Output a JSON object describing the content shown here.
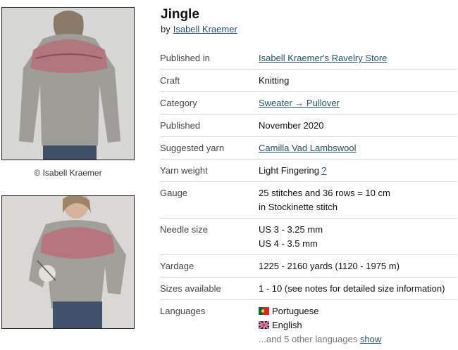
{
  "pattern": {
    "title": "Jingle",
    "by_prefix": "by",
    "designer": "Isabell Kraemer"
  },
  "photos": {
    "caption": "© Isabell Kraemer",
    "icons": [
      "sweater-back-photo",
      "sweater-front-photo"
    ]
  },
  "details": {
    "published_in": {
      "label": "Published in",
      "value": "Isabell Kraemer's Ravelry Store"
    },
    "craft": {
      "label": "Craft",
      "value": "Knitting"
    },
    "category": {
      "label": "Category",
      "value": "Sweater → Pullover"
    },
    "published": {
      "label": "Published",
      "value": "November 2020"
    },
    "yarn": {
      "label": "Suggested yarn",
      "value": "Camilla Vad Lambswool"
    },
    "weight": {
      "label": "Yarn weight",
      "value": "Light Fingering",
      "help": "?"
    },
    "gauge": {
      "label": "Gauge",
      "line1": "25 stitches and 36 rows = 10 cm",
      "line2": "in Stockinette stitch"
    },
    "needles": {
      "label": "Needle size",
      "line1": "US 3 - 3.25 mm",
      "line2": "US 4 - 3.5 mm"
    },
    "yardage": {
      "label": "Yardage",
      "value": "1225 - 2160 yards (1120 - 1975 m)"
    },
    "sizes": {
      "label": "Sizes available",
      "value": "1 - 10 (see notes for detailed size information)"
    },
    "languages": {
      "label": "Languages",
      "items": [
        {
          "name": "Portuguese",
          "flag": "portugal-flag-icon"
        },
        {
          "name": "English",
          "flag": "uk-flag-icon"
        }
      ],
      "more_text": "...and 5 other languages",
      "show_link": "show"
    }
  },
  "colors": {
    "link": "#1f4f6b",
    "divider": "#d4d4d4",
    "yoke": "#b56a72",
    "sweater": "#9c9b94"
  }
}
